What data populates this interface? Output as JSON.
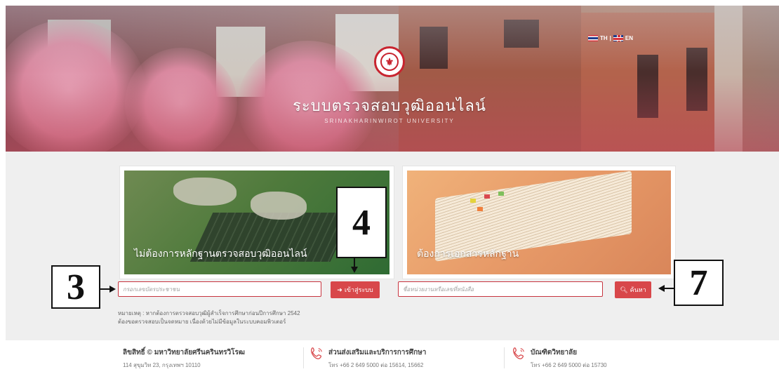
{
  "hero": {
    "title": "ระบบตรวจสอบวุฒิออนไลน์",
    "subtitle": "SRINAKHARINWIROT UNIVERSITY",
    "lang_th": "TH",
    "lang_separator": "|",
    "lang_en": "EN"
  },
  "left_card": {
    "caption": "ไม่ต้องการหลักฐานตรวจสอบวุฒิออนไลน์",
    "input_placeholder": "กรอกเลขบัตรประชาชน",
    "button_label": "เข้าสู่ระบบ",
    "button_icon": "login-icon",
    "note_line1": "หมายเหตุ : หากต้องการตรวจสอบวุฒิผู้สำเร็จการศึกษาก่อนปีการศึกษา 2542",
    "note_line2": "ต้องขอตรวจสอบเป็นจดหมาย เนื่องด้วยไม่มีข้อมูลในระบบคอมพิวเตอร์"
  },
  "right_card": {
    "caption": "ต้องการเอกสารหลักฐาน",
    "input_placeholder": "ชื่อหน่วยงานหรือเลขที่หนังสือ",
    "button_label": "ค้นหา",
    "button_icon": "search-icon"
  },
  "callouts": {
    "c3": "3",
    "c4": "4",
    "c7": "7"
  },
  "footer": {
    "col1_title": "ลิขสิทธิ์ © มหาวิทยาลัยศรีนครินทรวิโรฒ",
    "col1_text": "114 สุขุมวิท 23, กรุงเทพฯ 10110",
    "col2_title": "ส่วนส่งเสริมและบริการการศึกษา",
    "col2_text": "โทร +66 2 649 5000 ต่อ 15614, 15662",
    "col3_title": "บัณฑิตวิทยาลัย",
    "col3_text": "โทร +66 2 649 5000 ต่อ 15730"
  },
  "colors": {
    "accent": "#d8474a",
    "input_border": "#c7343f"
  }
}
